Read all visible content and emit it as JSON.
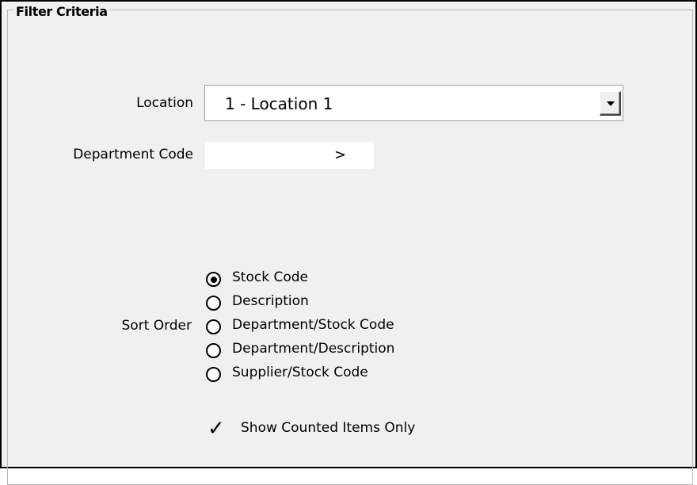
{
  "group": {
    "title": "Filter Criteria"
  },
  "location": {
    "label": "Location",
    "value": "1 - Location 1"
  },
  "department": {
    "label": "Department Code",
    "value": "",
    "button": ">"
  },
  "sort_order": {
    "label": "Sort Order",
    "selected": "Stock Code",
    "options": [
      {
        "label": "Stock Code",
        "checked": true
      },
      {
        "label": "Description",
        "checked": false
      },
      {
        "label": "Department/Stock Code",
        "checked": false
      },
      {
        "label": "Department/Description",
        "checked": false
      },
      {
        "label": "Supplier/Stock Code",
        "checked": false
      }
    ]
  },
  "show_counted": {
    "label": "Show Counted Items Only",
    "checked": true
  }
}
